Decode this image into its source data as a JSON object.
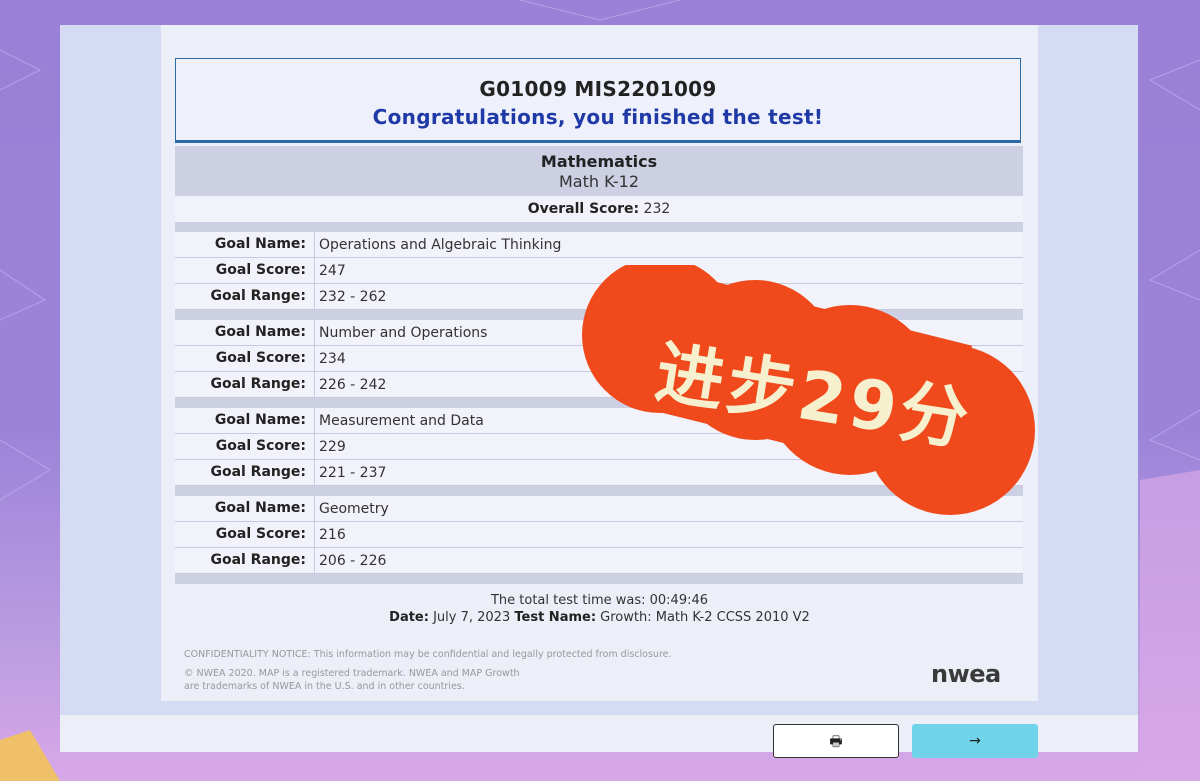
{
  "header": {
    "id_line": "G01009 MIS2201009",
    "congrats": "Congratulations, you finished the test!"
  },
  "subject": {
    "name": "Mathematics",
    "level": "Math K-12"
  },
  "overall": {
    "label": "Overall Score:",
    "value": "232"
  },
  "goals": [
    {
      "name_label": "Goal Name:",
      "name": "Operations and Algebraic Thinking",
      "score_label": "Goal Score:",
      "score": "247",
      "range_label": "Goal Range:",
      "range": "232 - 262"
    },
    {
      "name_label": "Goal Name:",
      "name": "Number and Operations",
      "score_label": "Goal Score:",
      "score": "234",
      "range_label": "Goal Range:",
      "range": "226 - 242"
    },
    {
      "name_label": "Goal Name:",
      "name": "Measurement and Data",
      "score_label": "Goal Score:",
      "score": "229",
      "range_label": "Goal Range:",
      "range": "221 - 237"
    },
    {
      "name_label": "Goal Name:",
      "name": "Geometry",
      "score_label": "Goal Score:",
      "score": "216",
      "range_label": "Goal Range:",
      "range": "206 - 226"
    }
  ],
  "footer": {
    "test_time": "The total test time was: 00:49:46",
    "date_label": "Date:",
    "date": "July 7, 2023",
    "test_name_label": "Test Name:",
    "test_name": "Growth: Math K-2 CCSS 2010 V2",
    "confidential": "CONFIDENTIALITY NOTICE: This information may be confidential and legally protected from disclosure.",
    "copyright_1": "© NWEA 2020. MAP is a registered trademark. NWEA and MAP Growth",
    "copyright_2": "are trademarks of NWEA in the U.S. and in other countries.",
    "logo": "nwea"
  },
  "buttons": {
    "print_icon": "printer-icon",
    "print_glyph": "🖶",
    "next_icon": "arrow-right-icon",
    "next_glyph": "→"
  },
  "sticker": {
    "text": "进步29分",
    "color": "#f04a1c"
  },
  "colors": {
    "accent_blue": "#1f3aa6",
    "border_blue": "#2c6aa6",
    "next_button": "#6fd3ea"
  }
}
